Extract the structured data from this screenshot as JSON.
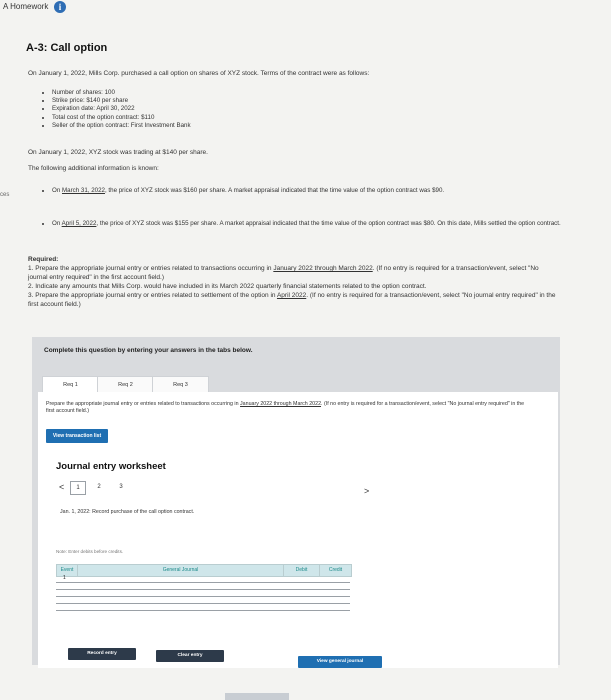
{
  "app": {
    "title": "A Homework",
    "info_glyph": "i",
    "left_edge_text": "ces"
  },
  "question": {
    "title": "A-3: Call option",
    "intro": "On January 1, 2022, Mills Corp. purchased a call option on shares of XYZ stock. Terms of the contract were as follows:",
    "terms": [
      "Number of shares: 100",
      "Strike price: $140 per share",
      "Expiration date: April 30, 2022",
      "Total cost of the option contract: $110",
      "Seller of the option contract: First Investment Bank"
    ],
    "trading_line": "On January 1, 2022, XYZ stock was trading at $140 per share.",
    "additional_intro": "The following additional information is known:",
    "info1_date": "March 31, 2022",
    "info1_text": ", the price of XYZ stock was $160 per share. A market appraisal indicated that the time value of the option contract was $90.",
    "info2_date": "April 5, 2022",
    "info2_text": ", the price of XYZ stock was $155 per share. A market appraisal indicated that the time value of the option contract was $80. On this date, Mills settled the option contract.",
    "on_prefix": "On ",
    "required_label": "Required:",
    "req1_a": "1. Prepare the appropriate journal entry or entries related to transactions occurring in ",
    "req1_link": "January 2022 through March 2022",
    "req1_b": ". (If no entry is required for a transaction/event, select \"No journal entry required\" in the first account field.)",
    "req2": "2. Indicate any amounts that Mills Corp. would have included in its March 2022 quarterly financial statements related to the option contract.",
    "req3_a": "3. Prepare the appropriate journal entry or entries related to settlement of the option in ",
    "req3_link": "April 2022",
    "req3_b": ". (If no entry is required for a transaction/event, select \"No journal entry required\" in the first account field.)"
  },
  "panel": {
    "heading": "Complete this question by entering your answers in the tabs below.",
    "tabs": [
      "Req 1",
      "Req 2",
      "Req 3"
    ],
    "tab_desc_a": "Prepare the appropriate journal entry or entries related to transactions occurring in ",
    "tab_desc_link": "January 2022 through March 2022",
    "tab_desc_b": ". (If no entry is required for a transaction/event, select \"No journal entry required\" in the first account field.)",
    "view_transaction_list": "View transaction list"
  },
  "worksheet": {
    "title": "Journal entry worksheet",
    "prev": "<",
    "next": ">",
    "pages": [
      "1",
      "2",
      "3"
    ],
    "entry_description": "Jan. 1, 2022: Record purchase of the call option contract.",
    "note": "Note: Enter debits before credits.",
    "columns": {
      "event": "Event",
      "general_journal": "General Journal",
      "debit": "Debit",
      "credit": "Credit"
    },
    "rows": [
      {
        "event": "1"
      },
      {
        "event": ""
      },
      {
        "event": ""
      },
      {
        "event": ""
      },
      {
        "event": ""
      }
    ],
    "buttons": {
      "record": "Record entry",
      "clear": "Clear entry",
      "view_general": "View general journal"
    }
  },
  "colors": {
    "accent": "#1f6fb2",
    "dark_button": "#2d3a4a",
    "table_header": "#cfe6ea",
    "link_text": "#1c8a8a"
  }
}
